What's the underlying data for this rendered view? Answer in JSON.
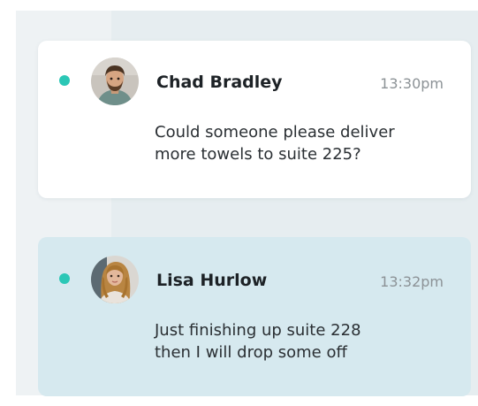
{
  "messages": [
    {
      "name": "Chad Bradley",
      "time": "13:30pm",
      "text": "Could someone please deliver\nmore towels to suite 225?",
      "avatar": "male-user-avatar",
      "unread": true
    },
    {
      "name": "Lisa Hurlow",
      "time": "13:32pm",
      "text": "Just finishing up suite 228\nthen I will drop some off",
      "avatar": "female-user-avatar",
      "unread": true
    }
  ],
  "colors": {
    "unread_dot": "#2bc7b6",
    "card_default": "#ffffff",
    "card_highlight": "#d6e9ef",
    "background": "#e6edf0"
  }
}
